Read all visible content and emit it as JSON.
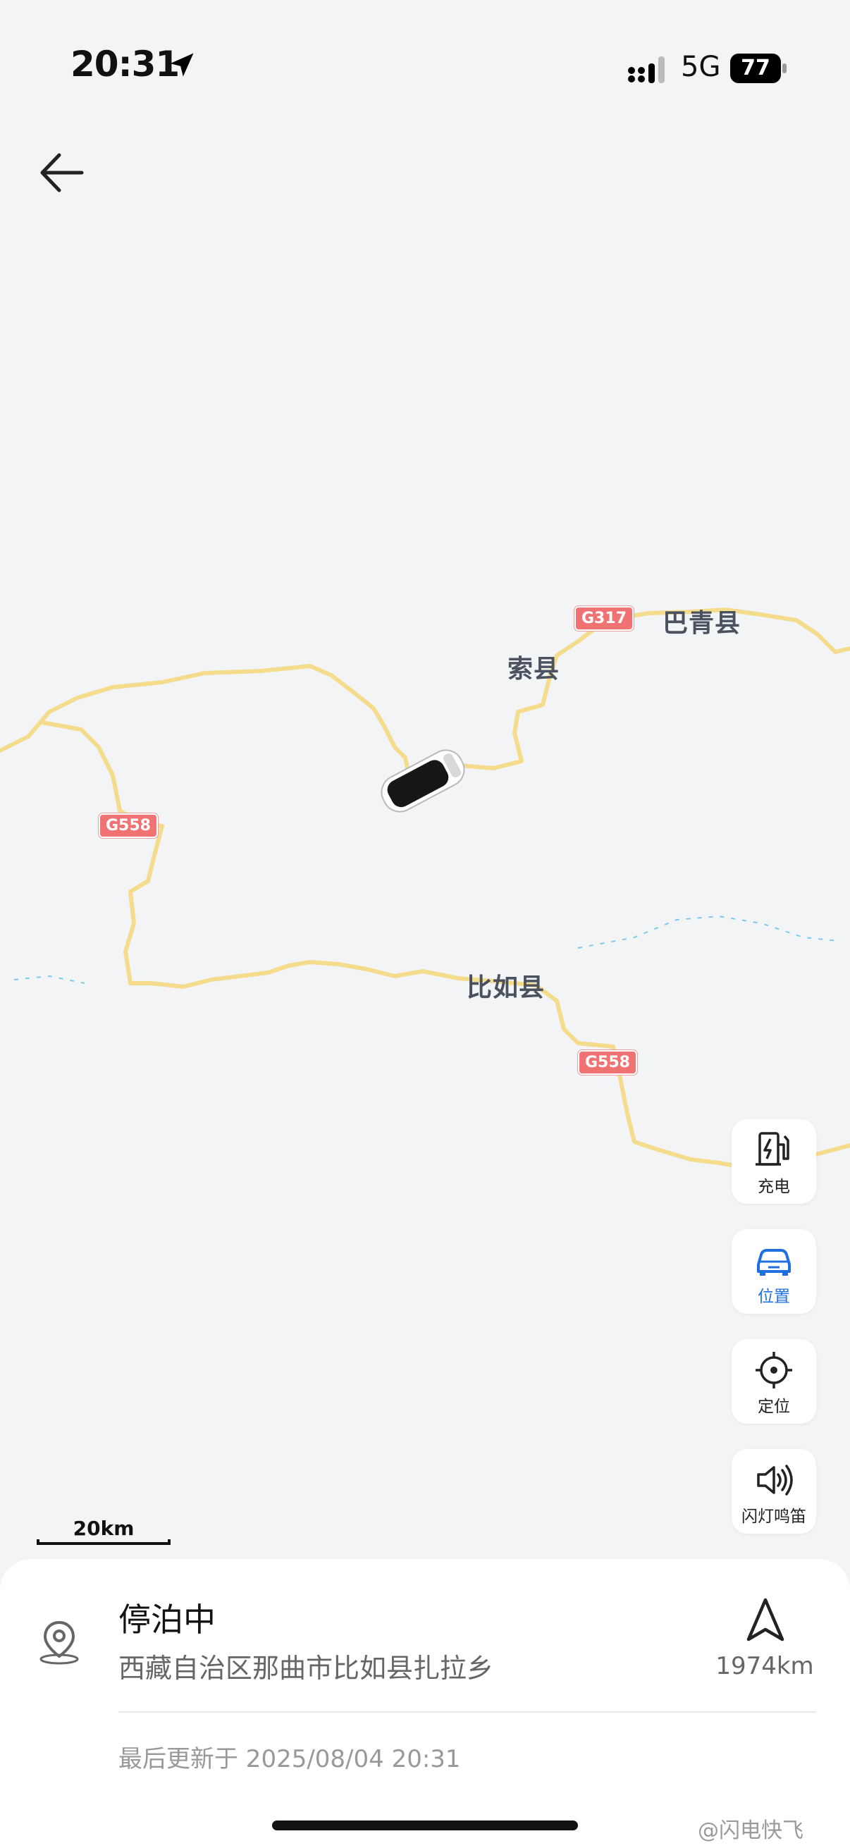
{
  "status_bar": {
    "time": "20:31",
    "network": "5G",
    "battery": "77",
    "icons": [
      "location-arrow-icon",
      "signal-icon",
      "battery-icon"
    ]
  },
  "header": {
    "back_icon": "arrow-left-icon"
  },
  "map": {
    "place_labels": [
      "巴青县",
      "索县",
      "比如县"
    ],
    "road_shields": [
      "G317",
      "G558",
      "G558"
    ],
    "scale_label": "20km",
    "road_color": "#f4dc8c",
    "shield_color": "#f07272"
  },
  "side_buttons": [
    {
      "label": "充电",
      "icon": "charging-station-icon"
    },
    {
      "label": "位置",
      "icon": "car-icon",
      "active": true
    },
    {
      "label": "定位",
      "icon": "crosshair-icon"
    },
    {
      "label": "闪灯鸣笛",
      "icon": "speaker-icon"
    }
  ],
  "panel": {
    "status": "停泊中",
    "address": "西藏自治区那曲市比如县扎拉乡",
    "distance": "1974km",
    "updated": "最后更新于 2025/08/04 20:31"
  },
  "watermark": "@闪电快飞",
  "colors": {
    "accent": "#1f6fe0",
    "background": "#f3f4f6"
  }
}
